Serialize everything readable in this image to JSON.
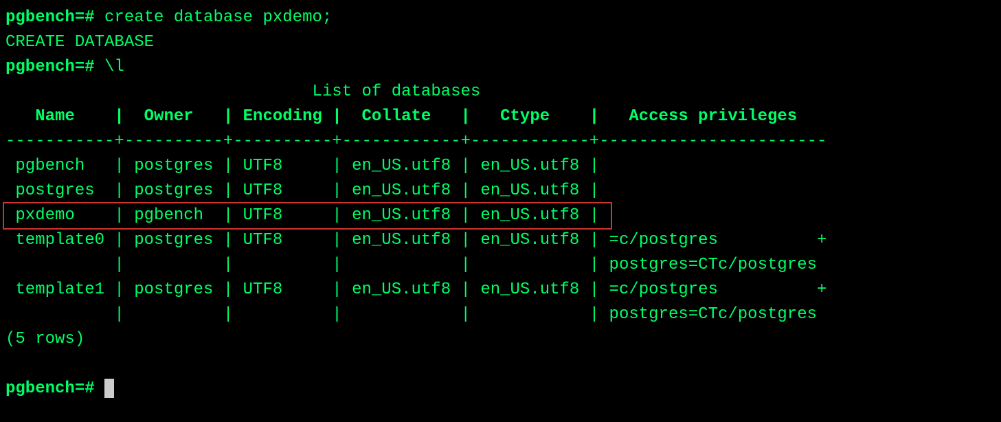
{
  "prompt": "pgbench=#",
  "cmd1": "create database pxdemo;",
  "response1": "CREATE DATABASE",
  "cmd2": "\\l",
  "table": {
    "title": "List of databases",
    "sep": "-----------+----------+----------+------------+------------+-----------------------",
    "headers": "   Name    |  Owner   | Encoding |  Collate   |   Ctype    |   Access privileges   ",
    "rows": [
      " pgbench   | postgres | UTF8     | en_US.utf8 | en_US.utf8 | ",
      " postgres  | postgres | UTF8     | en_US.utf8 | en_US.utf8 | ",
      " pxdemo    | pgbench  | UTF8     | en_US.utf8 | en_US.utf8 | ",
      " template0 | postgres | UTF8     | en_US.utf8 | en_US.utf8 | =c/postgres          +",
      "           |          |          |            |            | postgres=CTc/postgres",
      " template1 | postgres | UTF8     | en_US.utf8 | en_US.utf8 | =c/postgres          +",
      "           |          |          |            |            | postgres=CTc/postgres"
    ],
    "footer": "(5 rows)"
  }
}
